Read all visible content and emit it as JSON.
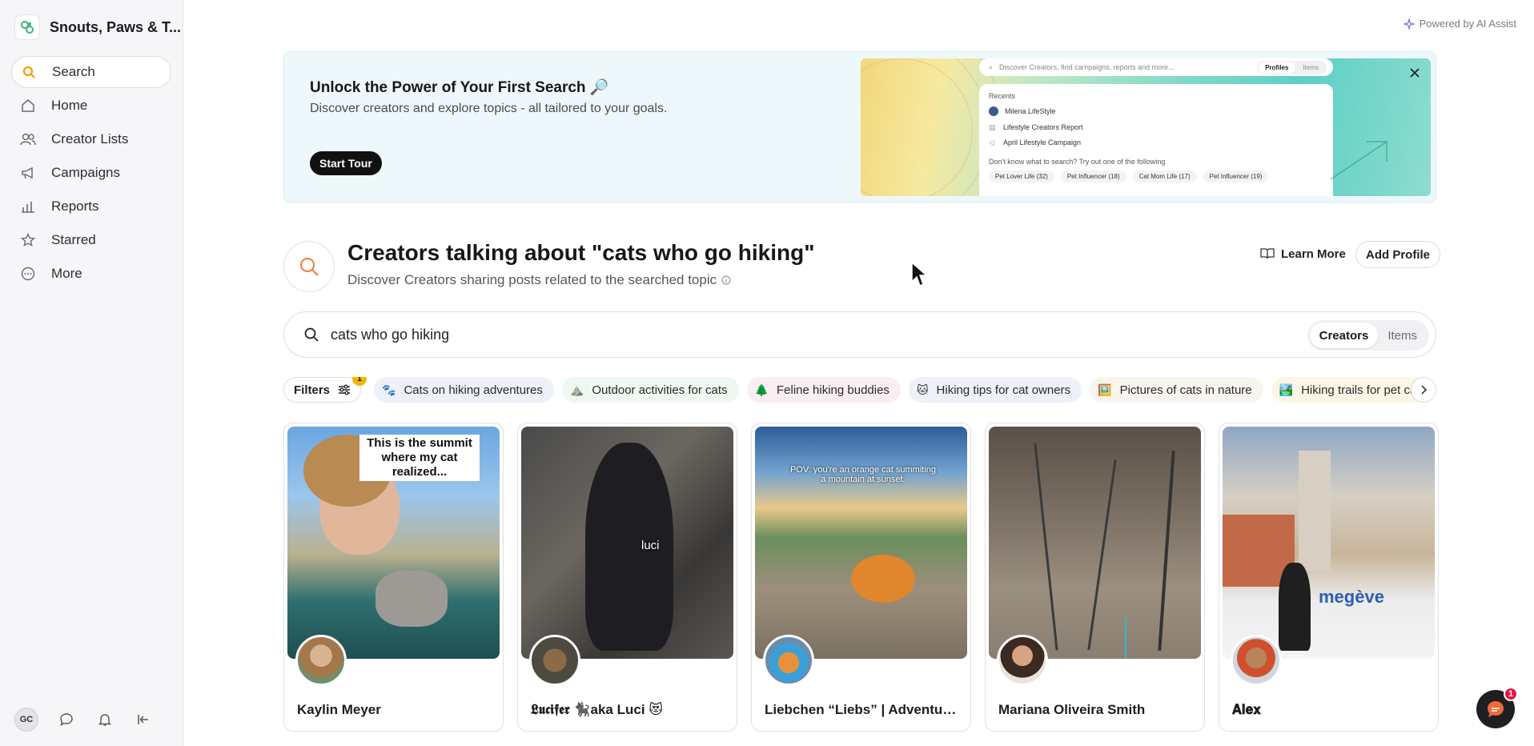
{
  "sidebar": {
    "brand": "Snouts, Paws & T...",
    "items": [
      {
        "label": "Search",
        "icon": "search-icon"
      },
      {
        "label": "Home",
        "icon": "home-icon"
      },
      {
        "label": "Creator Lists",
        "icon": "users-icon"
      },
      {
        "label": "Campaigns",
        "icon": "megaphone-icon"
      },
      {
        "label": "Reports",
        "icon": "bar-chart-icon"
      },
      {
        "label": "Starred",
        "icon": "star-icon"
      },
      {
        "label": "More",
        "icon": "more-icon"
      }
    ],
    "user_initials": "GC"
  },
  "powered_by": "Powered by AI Assist",
  "banner": {
    "title": "Unlock the Power of Your First Search 🔎",
    "subtitle": "Discover creators and explore topics - all tailored to your goals.",
    "button": "Start Tour",
    "preview": {
      "search_placeholder": "Discover Creators, find campaigns, reports and more...",
      "tabs": [
        "Profiles",
        "Items"
      ],
      "recents_label": "Recents",
      "recents": [
        "Milena LifeStyle",
        "Lifestyle Creators Report",
        "April Lifestyle Campaign"
      ],
      "hint": "Don't know what to search? Try out one of the following",
      "suggestions": [
        "Pet Lover Life (32)",
        "Pet Influencer (18)",
        "Cat Mom Life (17)",
        "Pet Influencer (19)"
      ]
    }
  },
  "header": {
    "title": "Creators talking about \"cats who go hiking\"",
    "subtitle": "Discover Creators sharing posts related to the searched topic",
    "learn_more": "Learn More",
    "add_profile": "Add Profile"
  },
  "search": {
    "value": "cats who go hiking",
    "tabs": [
      "Creators",
      "Items"
    ],
    "active_tab": "Creators"
  },
  "filters": {
    "label": "Filters",
    "count": "1",
    "chips": [
      {
        "label": "Cats on hiking adventures",
        "emoji": "🐾",
        "color": "#eef1fa"
      },
      {
        "label": "Outdoor activities for cats",
        "emoji": "⛰️",
        "color": "#eef7f0"
      },
      {
        "label": "Feline hiking buddies",
        "emoji": "🌲",
        "color": "#fbeef2"
      },
      {
        "label": "Hiking tips for cat owners",
        "emoji": "🐱",
        "color": "#eef1fa"
      },
      {
        "label": "Pictures of cats in nature",
        "emoji": "🖼️",
        "color": "#f8f5ee"
      },
      {
        "label": "Hiking trails for pet cat",
        "emoji": "🏞️",
        "color": "#fdf6e6"
      }
    ]
  },
  "cards": [
    {
      "name": "Kaylin Meyer",
      "caption": "This is the summit where my cat realized..."
    },
    {
      "name": "𝕷𝖚𝖈𝖎𝖋𝖊𝖗 🐈‍⬛aka Luci 😻",
      "caption": "luci"
    },
    {
      "name": "Liebchen “Liebs” | Adventure ...",
      "caption": "POV: you're an orange cat summiting a mountain at sunset."
    },
    {
      "name": "Mariana Oliveira Smith",
      "caption": ""
    },
    {
      "name": "𝐀𝐥𝐞𝐱",
      "caption": "megève"
    }
  ],
  "chat": {
    "badge": "1"
  }
}
